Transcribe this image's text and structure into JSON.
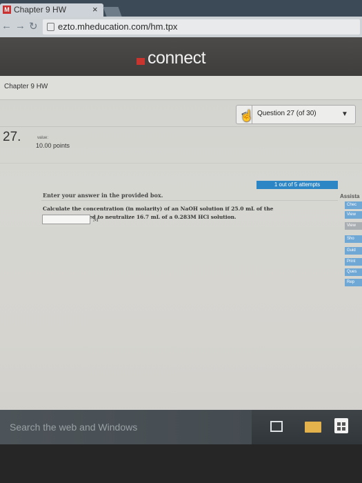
{
  "browser": {
    "tab_title": "Chapter 9 HW",
    "tab_close": "×",
    "favicon_letter": "M",
    "url": "ezto.mheducation.com/hm.tpx"
  },
  "header": {
    "brand": "connect"
  },
  "chapter": {
    "title": "Chapter 9 HW"
  },
  "question_nav": {
    "prev": "<",
    "label": "Question 27 (of 30)",
    "dropdown": "▼"
  },
  "question": {
    "number": "27.",
    "value_label": "value:",
    "points": "10.00 points",
    "attempts": "1 out of 5 attempts",
    "instruction": "Enter your answer in the provided box.",
    "text": "Calculate the concentration (in molarity) of an NaOH solution if 25.0 mL of the solution is needed to neutralize 16.7 mL of a 0.283M  HCl solution.",
    "answer_value": "",
    "unit": "M"
  },
  "assistance": {
    "title": "Assista",
    "buttons": [
      "Chec",
      "View",
      "View",
      "Sho",
      "Guid",
      "Print",
      "Ques",
      "Rep"
    ]
  },
  "taskbar": {
    "search_placeholder": "Search the web and Windows"
  },
  "colors": {
    "accent": "#2c86c6",
    "brand_red": "#c8342e",
    "header_bg": "#4d4b49"
  }
}
